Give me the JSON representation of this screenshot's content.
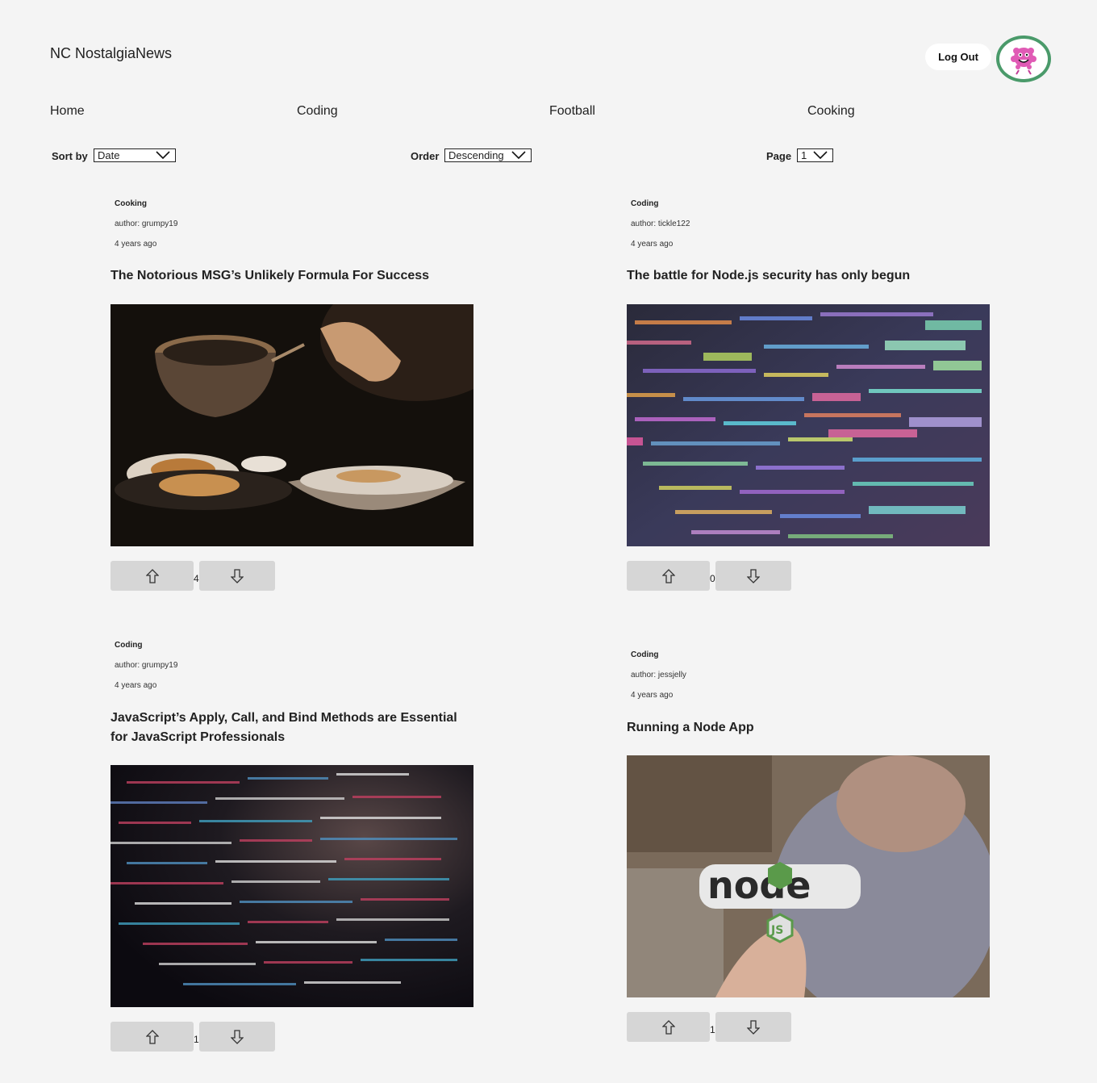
{
  "header": {
    "site_title": "NC NostalgiaNews",
    "logout_label": "Log Out",
    "avatar_icon": "pink-monster-avatar-icon"
  },
  "nav": {
    "topics": [
      "Home",
      "Coding",
      "Football",
      "Cooking"
    ]
  },
  "controls": {
    "sort_label": "Sort by",
    "sort_value": "Date",
    "order_label": "Order",
    "order_value": "Descending",
    "page_label": "Page",
    "page_value": "1"
  },
  "articles": [
    {
      "topic": "Cooking",
      "author": "author: grumpy19",
      "age": "4 years ago",
      "title": "The Notorious MSG’s Unlikely Formula For Success",
      "image": "cooking-photo",
      "votes": "4"
    },
    {
      "topic": "Coding",
      "author": "author: tickle122",
      "age": "4 years ago",
      "title": "The battle for Node.js security has only begun",
      "image": "code-screen-photo",
      "votes": "0"
    },
    {
      "topic": "Coding",
      "author": "author: grumpy19",
      "age": "4 years ago",
      "title": "JavaScript’s Apply, Call, and Bind Methods are Essential for JavaScript Professionals",
      "image": "dark-code-photo",
      "votes": "1"
    },
    {
      "topic": "Coding",
      "author": "author: jessjelly",
      "age": "4 years ago",
      "title": "Running a Node App",
      "image": "nodejs-sticker-photo",
      "votes": "1"
    }
  ],
  "icons": {
    "upvote": "arrow-up-icon",
    "downvote": "arrow-down-icon",
    "chevron": "chevron-down-icon"
  }
}
